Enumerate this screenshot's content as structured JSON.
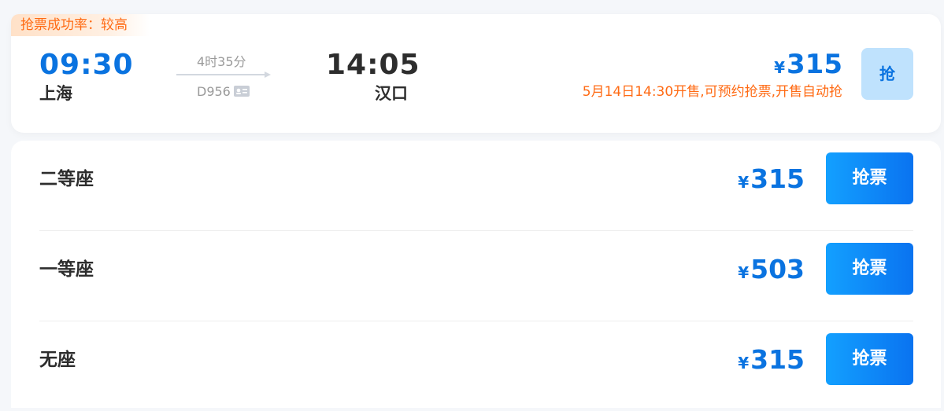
{
  "train": {
    "success_rate": "抢票成功率：较高",
    "departure_time": "09:30",
    "departure_station": "上海",
    "duration": "4时35分",
    "train_number": "D956",
    "arrival_time": "14:05",
    "arrival_station": "汉口",
    "currency": "¥",
    "min_price": "315",
    "presale_note": "5月14日14:30开售,可预约抢票,开售自动抢",
    "grab_label": "抢"
  },
  "seats": [
    {
      "name": "二等座",
      "currency": "¥",
      "price": "315",
      "button": "抢票"
    },
    {
      "name": "一等座",
      "currency": "¥",
      "price": "503",
      "button": "抢票"
    },
    {
      "name": "无座",
      "currency": "¥",
      "price": "315",
      "button": "抢票"
    }
  ],
  "colors": {
    "accent_blue": "#0a73e0",
    "warning_orange": "#ff6a13",
    "button_light_blue": "#bfe2fd"
  }
}
